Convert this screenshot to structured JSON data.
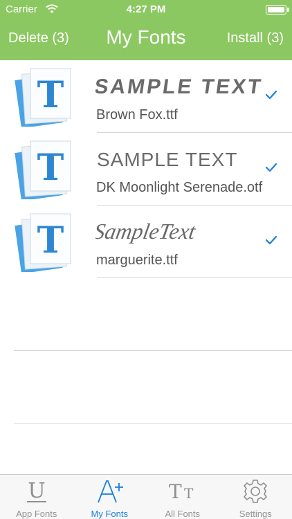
{
  "status_bar": {
    "carrier": "Carrier",
    "time": "4:27 PM"
  },
  "nav": {
    "delete_label": "Delete (3)",
    "title": "My Fonts",
    "install_label": "Install (3)",
    "bar_color": "#8cc862"
  },
  "fonts": [
    {
      "sample": "SAMPLE TEXT",
      "filename": "Brown Fox.ttf",
      "checked": true
    },
    {
      "sample": "SAMPLE TEXT",
      "filename": "DK Moonlight Serenade.otf",
      "checked": true
    },
    {
      "sample": "SampleText",
      "filename": "marguerite.ttf",
      "checked": true
    }
  ],
  "tabs": [
    {
      "label": "App Fonts",
      "icon": "underline-u-icon",
      "active": false
    },
    {
      "label": "My Fonts",
      "icon": "font-add-icon",
      "active": true
    },
    {
      "label": "All Fonts",
      "icon": "text-size-icon",
      "active": false
    },
    {
      "label": "Settings",
      "icon": "gear-icon",
      "active": false
    }
  ],
  "accent_color": "#1a7fe0"
}
